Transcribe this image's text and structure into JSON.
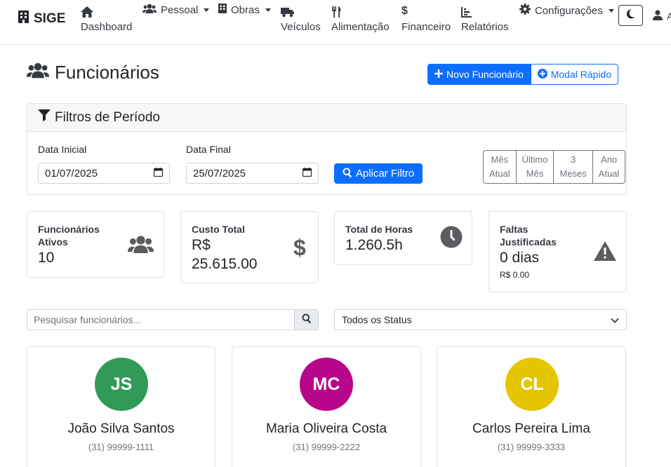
{
  "brand": {
    "name": "SIGE",
    "icon": "building-icon"
  },
  "nav": {
    "dashboard": {
      "label": "Dashboard",
      "icon": "home-icon"
    },
    "pessoal": {
      "label": "Pessoal",
      "icon": "users-icon"
    },
    "obras": {
      "label": "Obras",
      "icon": "building-icon"
    },
    "veiculos": {
      "label": "Veículos",
      "icon": "truck-icon"
    },
    "alimentacao": {
      "label": "Alimentação",
      "icon": "utensils-icon"
    },
    "financeiro": {
      "label": "Financeiro",
      "icon": "dollar-icon"
    },
    "relatorios": {
      "label": "Relatórios",
      "icon": "chart-icon"
    },
    "configuracoes": {
      "label": "Configurações",
      "icon": "gear-icon"
    },
    "user_initial": "A"
  },
  "header": {
    "title": "Funcionários",
    "new_button": "Novo Funcionário",
    "modal_button": "Modal Rápido"
  },
  "filters": {
    "title": "Filtros de Período",
    "start_label": "Data Inicial",
    "start_value": "01/07/2025",
    "end_label": "Data Final",
    "end_value": "25/07/2025",
    "apply_button": "Aplicar Filtro",
    "periods": [
      {
        "line1": "Mês",
        "line2": "Atual"
      },
      {
        "line1": "Último",
        "line2": "Mês"
      },
      {
        "line1": "3",
        "line2": "Meses"
      },
      {
        "line1": "Ano",
        "line2": "Atual"
      }
    ]
  },
  "stats": {
    "active": {
      "label_line1": "Funcionários",
      "label_line2": "Ativos",
      "value": "10"
    },
    "cost": {
      "label": "Custo Total",
      "value_line1": "R$",
      "value_line2": "25.615.00"
    },
    "hours": {
      "label": "Total de Horas",
      "value": "1.260.5h"
    },
    "absences": {
      "label_line1": "Faltas",
      "label_line2": "Justificadas",
      "value": "0 dias",
      "sub": "R$ 0.00"
    }
  },
  "search": {
    "placeholder": "Pesquisar funcionários...",
    "status_value": "Todos os Status"
  },
  "employees": [
    {
      "initials": "JS",
      "name": "João Silva Santos",
      "phone": "(31) 99999-1111",
      "color": "#329a58"
    },
    {
      "initials": "MC",
      "name": "Maria Oliveira Costa",
      "phone": "(31) 99999-2222",
      "color": "#b8068b"
    },
    {
      "initials": "CL",
      "name": "Carlos Pereira Lima",
      "phone": "(31) 99999-3333",
      "color": "#e5c500"
    }
  ],
  "colors": {
    "primary": "#0d6efd",
    "icon_gray": "#5a5c5f"
  }
}
